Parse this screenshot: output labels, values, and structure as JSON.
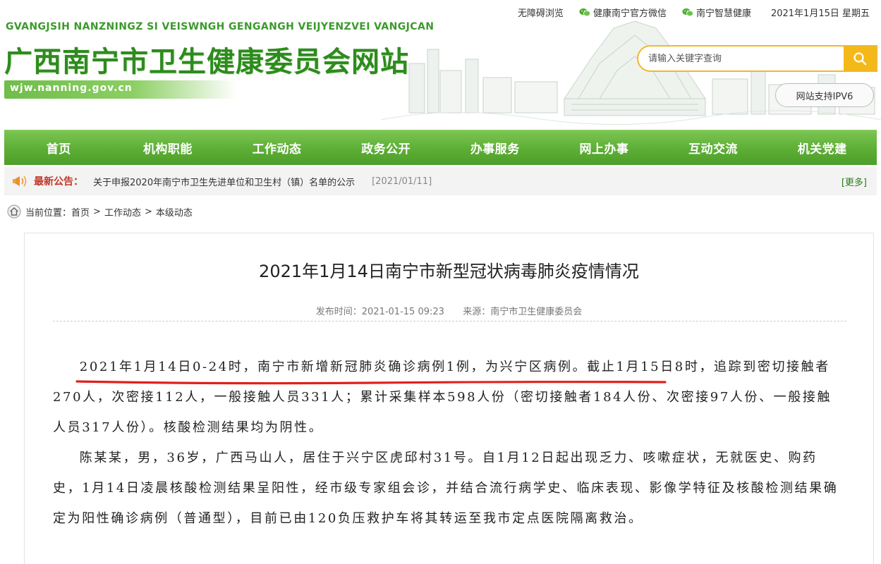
{
  "header": {
    "pinyin": "GVANGJSIH NANZNINGZ SI VEISWNGH GENGANGH VEIJYENZVEI VANGJCAN",
    "title": "广西南宁市卫生健康委员会网站",
    "domain": "wjw.nanning.gov.cn",
    "toplinks": {
      "accessibility": "无障碍浏览",
      "wechat1": "健康南宁官方微信",
      "wechat2": "南宁智慧健康",
      "date": "2021年1月15日 星期五"
    },
    "search": {
      "placeholder": "请输入关键字查询"
    },
    "ipv6": "网站支持IPV6"
  },
  "nav": {
    "items": [
      "首页",
      "机构职能",
      "工作动态",
      "政务公开",
      "办事服务",
      "网上办事",
      "互动交流",
      "机关党建"
    ]
  },
  "notice": {
    "label": "最新公告：",
    "text": "关于申报2020年南宁市卫生先进单位和卫生村（镇）名单的公示",
    "date": "[2021/01/11]",
    "more": "[更多]"
  },
  "breadcrumb": {
    "label": "当前位置：",
    "items": [
      "首页",
      "工作动态",
      "本级动态"
    ],
    "sep": ">"
  },
  "article": {
    "title": "2021年1月14日南宁市新型冠状病毒肺炎疫情情况",
    "meta_time": "发布时间：2021-01-15 09:23",
    "meta_source": "来源：南宁市卫生健康委员会",
    "p1": "2021年1月14日0-24时，南宁市新增新冠肺炎确诊病例1例，为兴宁区病例。截止1月15日8时，追踪到密切接触者270人，次密接112人，一般接触人员331人；累计采集样本598人份（密切接触者184人份、次密接97人份、一般接触人员317人份）。核酸检测结果均为阴性。",
    "p2": "陈某某，男，36岁，广西马山人，居住于兴宁区虎邱村31号。自1月12日起出现乏力、咳嗽症状，无就医史、购药史，1月14日凌晨核酸检测结果呈阳性，经市级专家组会诊，并结合流行病学史、临床表现、影像学特征及核酸检测结果确定为阳性确诊病例（普通型），目前已由120负压救护车将其转运至我市定点医院隔离救治。"
  },
  "colors": {
    "brand_green": "#5cae35",
    "title_green": "#2e8b1f",
    "search_yellow": "#f5b819",
    "notice_red": "#c0392b",
    "underline_red": "#e0201c"
  },
  "icons": [
    "wechat-icon",
    "search-icon",
    "bell-icon",
    "home-icon"
  ]
}
